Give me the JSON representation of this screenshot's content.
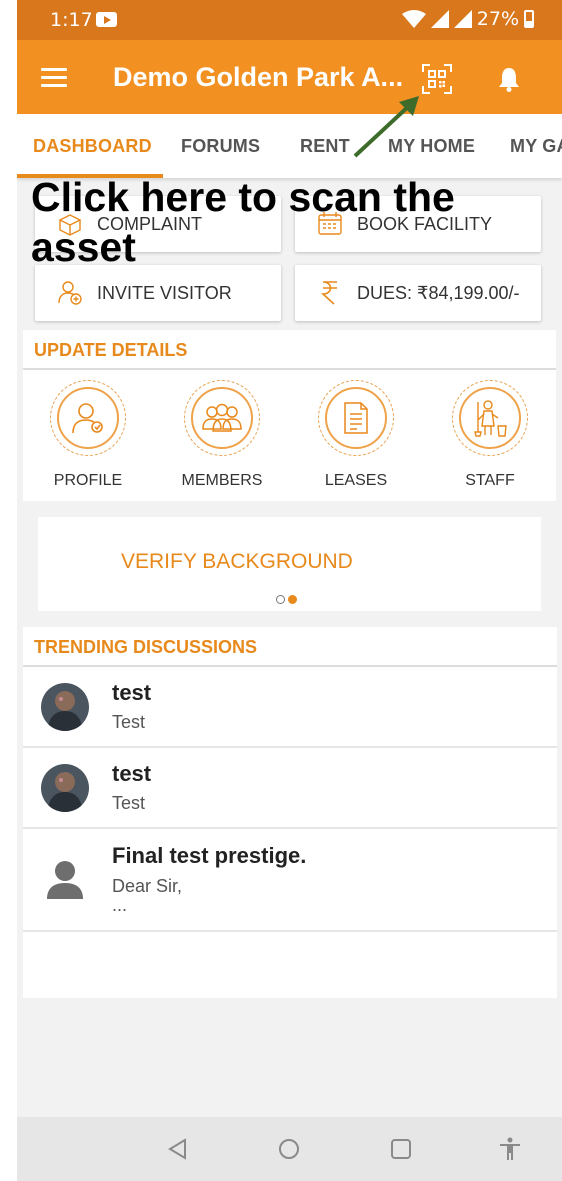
{
  "status_bar": {
    "time": "1:17",
    "battery": "27%"
  },
  "app_bar": {
    "title": "Demo Golden Park A..."
  },
  "tabs": [
    {
      "label": "DASHBOARD"
    },
    {
      "label": "FORUMS"
    },
    {
      "label": "RENT"
    },
    {
      "label": "MY HOME"
    },
    {
      "label": "MY GA"
    }
  ],
  "annotation": {
    "text": "Click here to scan the asset"
  },
  "quick_actions": [
    {
      "label": "COMPLAINT",
      "icon": "complaint-box-icon"
    },
    {
      "label": "BOOK FACILITY",
      "icon": "calendar-icon"
    },
    {
      "label": "INVITE VISITOR",
      "icon": "invite-visitor-icon"
    },
    {
      "label": "DUES: ₹84,199.00/-",
      "icon": "rupee-icon"
    }
  ],
  "update_details": {
    "header": "UPDATE DETAILS",
    "items": [
      {
        "label": "PROFILE",
        "icon": "profile-icon"
      },
      {
        "label": "MEMBERS",
        "icon": "members-icon"
      },
      {
        "label": "LEASES",
        "icon": "lease-document-icon"
      },
      {
        "label": "STAFF",
        "icon": "staff-icon"
      }
    ]
  },
  "banner": {
    "text": "VERIFY BACKGROUND",
    "carousel_pages": 2,
    "active_page": 2
  },
  "trending": {
    "header": "TRENDING DISCUSSIONS",
    "items": [
      {
        "title": "test",
        "subtitle": "Test"
      },
      {
        "title": "test",
        "subtitle": "Test"
      },
      {
        "title": "Final test prestige.",
        "subtitle": "Dear Sir,",
        "more": "..."
      }
    ]
  },
  "colors": {
    "primary": "#f29021",
    "status_bar": "#d9771d",
    "accent_text": "#e8891c",
    "arrow": "#3d6b2a"
  }
}
